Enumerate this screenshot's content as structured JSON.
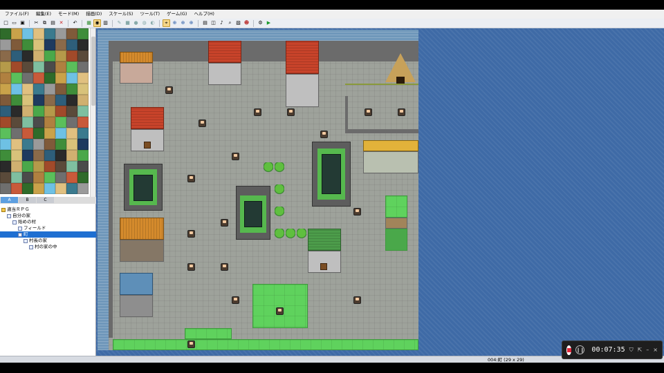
{
  "menu": [
    "ファイル(F)",
    "編集(E)",
    "モード(M)",
    "描画(D)",
    "スケール(S)",
    "ツール(T)",
    "ゲーム(G)",
    "ヘルプ(H)"
  ],
  "toolbar_icons": [
    "new-icon",
    "open-icon",
    "save-icon",
    "cut-icon",
    "copy-icon",
    "paste-icon",
    "delete-icon",
    "undo-icon",
    "map-mode-icon",
    "event-mode-icon",
    "region-mode-icon",
    "pencil-icon",
    "rectangle-icon",
    "ellipse-icon",
    "fill-icon",
    "shadow-pen-icon",
    "select-icon",
    "zoom-1-icon",
    "zoom-2-icon",
    "zoom-4-icon",
    "database-icon",
    "plugin-icon",
    "sound-icon",
    "event-search-icon",
    "resource-icon",
    "character-gen-icon",
    "settings-icon",
    "playtest-icon"
  ],
  "tileset_tabs": [
    "A",
    "B",
    "C"
  ],
  "map_tree": [
    {
      "label": "適当ＲＰＧ",
      "level": 0,
      "game": true
    },
    {
      "label": "自分の家",
      "level": 1
    },
    {
      "label": "始めの村",
      "level": 2
    },
    {
      "label": "フィールド",
      "level": 3
    },
    {
      "label": "町",
      "level": 3,
      "selected": true
    },
    {
      "label": "村長の家",
      "level": 4
    },
    {
      "label": "村の家の中",
      "level": 5
    }
  ],
  "status": {
    "map_info": "004:町 (29 x 29)"
  },
  "recorder": {
    "time": "00:07:35"
  },
  "colors": {
    "selection": "#1f6fd1",
    "map_background": "#3e6aa6",
    "record": "#e0263a"
  }
}
